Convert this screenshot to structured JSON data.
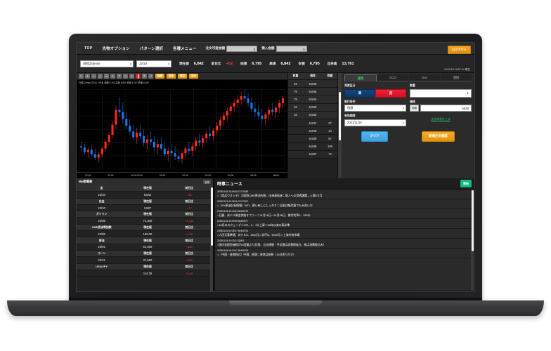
{
  "topnav": {
    "items": [
      "TOP",
      "先物オプション",
      "パターン選択",
      "各種メニュー"
    ],
    "order_power_label": "注文可能金額",
    "order_power_value": "0",
    "deposit_label": "預入金額",
    "deposit_value": "0",
    "logout_label": "ログアウト"
  },
  "quotebar": {
    "product": "日経225mini",
    "month": "22/10",
    "fields": [
      {
        "label": "現在値",
        "value": "6,842",
        "up": false
      },
      {
        "label": "前日比",
        "value": "+52",
        "up": true
      },
      {
        "label": "始値",
        "value": "6,795",
        "up": false
      },
      {
        "label": "高値",
        "value": "6,842",
        "up": false
      },
      {
        "label": "安値",
        "value": "6,795",
        "up": false
      },
      {
        "label": "出来高",
        "value": "13,761",
        "up": false
      }
    ],
    "timestamp": "21/11/16 10:57:54 現在"
  },
  "chart": {
    "tools": [
      {
        "name": "cursor-icon",
        "glyph": "↖"
      },
      {
        "name": "crosshair-icon",
        "glyph": "✛"
      },
      {
        "name": "hline-icon",
        "glyph": "—"
      },
      {
        "name": "trendline-icon",
        "glyph": "╱"
      },
      {
        "name": "channel-icon",
        "glyph": "☰"
      },
      {
        "name": "fib-icon",
        "glyph": "≡"
      },
      {
        "name": "text-icon",
        "glyph": "T"
      },
      {
        "name": "shape-icon",
        "glyph": "◇"
      },
      {
        "name": "magnet-icon",
        "glyph": "⚭"
      },
      {
        "name": "candle-icon",
        "glyph": "▐"
      },
      {
        "name": "lock-icon",
        "glyph": "⚿"
      },
      {
        "name": "chart-type-icon",
        "glyph": "↗"
      }
    ],
    "buttons": [
      "指標",
      "設定",
      "保存",
      "表示"
    ],
    "caption": "日経225mini 22/10 1分足 始値 6,791 高値 6,843 安値 6,787 終値 6,842",
    "xaxis": [
      "22:00",
      "23:00",
      "11/16 00:00",
      "01:00",
      "02:00",
      "03:00",
      "04:00",
      "05:00",
      "06:00"
    ],
    "chart_data": {
      "type": "candlestick",
      "title": "日経225mini 22/10 1分足",
      "xlabel": "",
      "ylabel": "",
      "ylim": [
        6780,
        6850
      ],
      "grid": true,
      "x": [
        "22:00",
        "23:00",
        "11/16 00:00",
        "01:00",
        "02:00",
        "03:00",
        "04:00",
        "05:00",
        "06:00"
      ],
      "ohlc": [
        [
          6800,
          6804,
          6796,
          6799
        ],
        [
          6799,
          6802,
          6793,
          6795
        ],
        [
          6795,
          6799,
          6790,
          6797
        ],
        [
          6797,
          6801,
          6792,
          6793
        ],
        [
          6793,
          6798,
          6788,
          6790
        ],
        [
          6790,
          6795,
          6786,
          6793
        ],
        [
          6793,
          6800,
          6790,
          6798
        ],
        [
          6798,
          6806,
          6795,
          6804
        ],
        [
          6804,
          6812,
          6801,
          6810
        ],
        [
          6810,
          6822,
          6807,
          6819
        ],
        [
          6819,
          6836,
          6815,
          6832
        ],
        [
          6832,
          6843,
          6826,
          6830
        ],
        [
          6830,
          6838,
          6820,
          6824
        ],
        [
          6824,
          6830,
          6815,
          6818
        ],
        [
          6818,
          6824,
          6810,
          6813
        ],
        [
          6813,
          6819,
          6805,
          6808
        ],
        [
          6808,
          6816,
          6802,
          6812
        ],
        [
          6812,
          6818,
          6806,
          6809
        ],
        [
          6809,
          6815,
          6800,
          6803
        ],
        [
          6803,
          6810,
          6797,
          6806
        ],
        [
          6806,
          6813,
          6801,
          6804
        ],
        [
          6804,
          6809,
          6796,
          6799
        ],
        [
          6799,
          6806,
          6793,
          6802
        ],
        [
          6802,
          6808,
          6796,
          6798
        ],
        [
          6798,
          6803,
          6790,
          6793
        ],
        [
          6793,
          6799,
          6787,
          6796
        ],
        [
          6796,
          6802,
          6791,
          6794
        ],
        [
          6794,
          6800,
          6788,
          6791
        ],
        [
          6791,
          6797,
          6786,
          6789
        ],
        [
          6789,
          6796,
          6785,
          6794
        ],
        [
          6794,
          6801,
          6790,
          6798
        ],
        [
          6798,
          6804,
          6793,
          6796
        ],
        [
          6796,
          6803,
          6791,
          6800
        ],
        [
          6800,
          6808,
          6796,
          6805
        ],
        [
          6805,
          6811,
          6800,
          6803
        ],
        [
          6803,
          6810,
          6798,
          6807
        ],
        [
          6807,
          6814,
          6803,
          6811
        ],
        [
          6811,
          6818,
          6806,
          6809
        ],
        [
          6809,
          6816,
          6805,
          6814
        ],
        [
          6814,
          6821,
          6810,
          6818
        ],
        [
          6818,
          6826,
          6814,
          6823
        ],
        [
          6823,
          6830,
          6818,
          6827
        ],
        [
          6827,
          6834,
          6822,
          6831
        ],
        [
          6831,
          6838,
          6827,
          6835
        ],
        [
          6835,
          6842,
          6830,
          6838
        ],
        [
          6838,
          6845,
          6833,
          6841
        ],
        [
          6841,
          6848,
          6836,
          6844
        ],
        [
          6844,
          6850,
          6839,
          6842
        ],
        [
          6842,
          6847,
          6835,
          6838
        ],
        [
          6838,
          6843,
          6830,
          6833
        ],
        [
          6833,
          6839,
          6826,
          6830
        ],
        [
          6830,
          6836,
          6823,
          6827
        ],
        [
          6827,
          6833,
          6820,
          6824
        ],
        [
          6824,
          6830,
          6818,
          6828
        ],
        [
          6828,
          6835,
          6823,
          6832
        ],
        [
          6832,
          6838,
          6827,
          6830
        ],
        [
          6830,
          6836,
          6825,
          6834
        ],
        [
          6834,
          6841,
          6829,
          6838
        ],
        [
          6838,
          6844,
          6833,
          6842
        ]
      ]
    }
  },
  "ladder": {
    "headers": [
      "数量",
      "値段",
      "数量"
    ],
    "rows": [
      {
        "bid": "45",
        "price": "6,846",
        "ask": "",
        "side": "ask"
      },
      {
        "bid": "75",
        "price": "6,845",
        "ask": "",
        "side": "ask"
      },
      {
        "bid": "78",
        "price": "6,844",
        "ask": "",
        "side": "ask"
      },
      {
        "bid": "53",
        "price": "6,843",
        "ask": "",
        "side": "ask"
      },
      {
        "bid": "32",
        "price": "6,842",
        "ask": "",
        "side": "ask"
      },
      {
        "bid": "",
        "price": "6,841",
        "ask": "27",
        "side": "bid"
      },
      {
        "bid": "",
        "price": "6,840",
        "ask": "44",
        "side": "bid"
      },
      {
        "bid": "",
        "price": "6,839",
        "ask": "67",
        "side": "bid"
      },
      {
        "bid": "",
        "price": "6,838",
        "ask": "105",
        "side": "bid"
      },
      {
        "bid": "",
        "price": "6,837",
        "ask": "74",
        "side": "bid"
      }
    ]
  },
  "order": {
    "tabs": [
      {
        "label": "通常",
        "active": true
      },
      {
        "label": "OCO",
        "active": false
      },
      {
        "label": "Duo",
        "active": false
      },
      {
        "label": "連続",
        "active": false
      }
    ],
    "side_label": "売買区分",
    "buy_label": "買",
    "sell_label": "売",
    "qty_label": "数量",
    "qty_value": "1",
    "exec_label": "執行条件",
    "exec_value": "指値",
    "price_label": "価格",
    "price_tag": "価格",
    "price_value": "6838",
    "expiry_label": "有効期限",
    "expiry_value": "2021/11/16",
    "link_label": "支払時条件とは",
    "clear_label": "クリア",
    "confirm_label": "新規注文確認"
  },
  "watchlist": {
    "title": "My相場表",
    "edit_label": "編集",
    "col_headers": [
      "銘柄",
      "現在値",
      "前日比"
    ],
    "rows": [
      {
        "name": "金",
        "month": "22/10",
        "price": "6,842",
        "chg": "+52"
      },
      {
        "name": "白金",
        "month": "22/10",
        "price": "3,987",
        "chg": "+77"
      },
      {
        "name": "ガソリン",
        "month": "22/05",
        "price": "71,300",
        "chg": "+1,140"
      },
      {
        "name": "CME原油等指数",
        "month": "22/05",
        "price": "185.00",
        "chg": "+2.55"
      },
      {
        "name": "原油",
        "month": "23/01",
        "price": "51,000",
        "chg": "+460"
      },
      {
        "name": "コーン",
        "month": "22/11",
        "price": "37,560",
        "chg": "+180"
      },
      {
        "name": "USD/JPY",
        "month": "",
        "price": "114.36",
        "chg": "+0.18"
      }
    ]
  },
  "news": {
    "title": "時事ニュース",
    "refresh_label": "更新",
    "items": [
      {
        "meta": "2025/11/16 10:56:48 CCC0038",
        "text": "○（商品ウオッチ）大阪取CME原油先物、出来高低迷＝個人への浸透課題―上場2カ月"
      },
      {
        "meta": "2025/11/16 10:53:06 CCC0037",
        "text": "○（NY原油分析情報）WTI、買い戻しにしっかり＝当限は帳尻買でもみ合いか"
      },
      {
        "meta": "2025/11/16 10:40:54 NNN0078",
        "text": "○日銀、米ドル資金供給オファー＝11月18日～11月26日、貸付利率0．330％"
      },
      {
        "meta": "2025/11/16 10:39:06 NNN0077",
        "text": "○10月のスウェーデンCPI、3．1％上昇＝08年以来の高水準"
      },
      {
        "meta": "2025/11/16 10:35:27 NNN0076",
        "text": "○人民元基準値、対ドル6．3924元＝対円5．6015元＝上海外為市場"
      },
      {
        "meta": "2025/11/16 10:33:21 QM01",
        "text": "○国内金販売価格が16営業ぶり反落、山元建値・予反値は消費税抜き、他は消費税込み）"
      },
      {
        "meta": "2025/11/16 10:33:17 NNN0075",
        "text": "○（中国・香港株式）中国、続落＝香港は続伸（16日寄り付き）"
      }
    ]
  }
}
